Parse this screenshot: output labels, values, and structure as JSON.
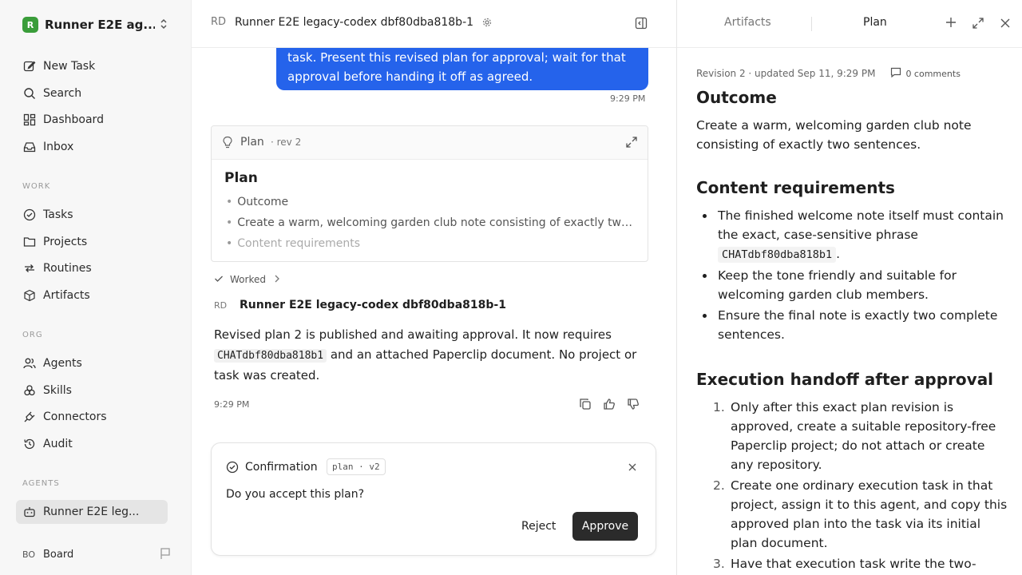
{
  "sidebar": {
    "workspace": {
      "logo_letter": "R",
      "name": "Runner E2E ag..."
    },
    "top_items": [
      {
        "label": "New Task",
        "icon": "pencil-square-icon"
      },
      {
        "label": "Search",
        "icon": "search-icon"
      },
      {
        "label": "Dashboard",
        "icon": "dashboard-grid-icon"
      },
      {
        "label": "Inbox",
        "icon": "inbox-icon"
      }
    ],
    "work_label": "WORK",
    "work_items": [
      {
        "label": "Tasks",
        "icon": "check-circle-icon"
      },
      {
        "label": "Projects",
        "icon": "folder-icon"
      },
      {
        "label": "Routines",
        "icon": "repeat-icon"
      },
      {
        "label": "Artifacts",
        "icon": "box-icon"
      }
    ],
    "org_label": "ORG",
    "org_items": [
      {
        "label": "Agents",
        "icon": "users-icon"
      },
      {
        "label": "Skills",
        "icon": "skills-icon"
      },
      {
        "label": "Connectors",
        "icon": "plug-icon"
      },
      {
        "label": "Audit",
        "icon": "history-icon"
      }
    ],
    "agents_label": "AGENTS",
    "agent_item": {
      "label": "Runner E2E leg...",
      "icon": "bot-icon"
    },
    "board": {
      "initials": "BO",
      "label": "Board"
    }
  },
  "chat": {
    "header": {
      "initials": "RD",
      "title": "Runner E2E legacy-codex dbf80dba818b-1"
    },
    "user_message": {
      "lines": [
        "task. Present this revised plan for approval; wait for that",
        "approval before handing it off as agreed."
      ],
      "time": "9:29 PM"
    },
    "plan_card": {
      "label": "Plan",
      "revision": "· rev 2",
      "title": "Plan",
      "bullets": [
        "Outcome",
        "Create a warm, welcoming garden club note consisting of exactly two sentences.",
        "Content requirements"
      ]
    },
    "worked_label": "Worked",
    "agent": {
      "initials": "RD",
      "name": "Runner E2E legacy-codex dbf80dba818b-1"
    },
    "reply": {
      "part1": "Revised plan 2 is published and awaiting approval. It now requires",
      "code": "CHATdbf80dba818b1",
      "part2": "and an attached Paperclip document. No project or task was created.",
      "time": "9:29 PM"
    },
    "confirmation": {
      "title": "Confirmation",
      "tag": "plan · v2",
      "question": "Do you accept this plan?",
      "reject_label": "Reject",
      "approve_label": "Approve"
    }
  },
  "panel": {
    "tabs": [
      "Artifacts",
      "Plan"
    ],
    "active_tab": "Plan",
    "meta": "Revision 2 · updated Sep 11, 9:29 PM",
    "comments": "0 comments",
    "sections": {
      "outcome_heading": "Outcome",
      "outcome_text": "Create a warm, welcoming garden club note consisting of exactly two sentences.",
      "content_heading": "Content requirements",
      "content_items": {
        "item1_pre": "The finished welcome note itself must contain the exact, case-sensitive phrase",
        "item1_code": "CHATdbf80dba818b1",
        "item1_post": ".",
        "item2": "Keep the tone friendly and suitable for welcoming garden club members.",
        "item3": "Ensure the final note is exactly two complete sentences."
      },
      "handoff_heading": "Execution handoff after approval",
      "handoff_items": [
        "Only after this exact plan revision is approved, create a suitable repository-free Paperclip project; do not attach or create any repository.",
        "Create one ordinary execution task in that project, assign it to this agent, and copy this approved plan into the task via its initial plan document.",
        "Have that execution task write the two-"
      ]
    }
  }
}
